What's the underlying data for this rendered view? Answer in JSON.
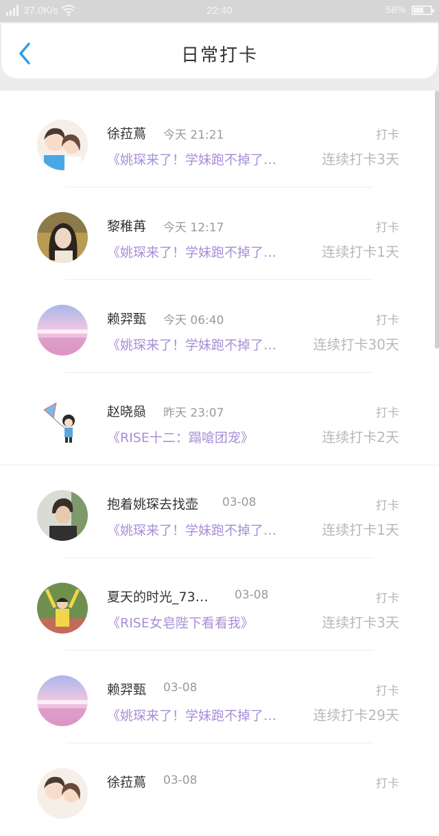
{
  "status": {
    "speed": "37.0K/s",
    "time": "22:40",
    "battery": "58%",
    "battery_level": 0.58
  },
  "header": {
    "title": "日常打卡"
  },
  "entries": [
    {
      "name": "徐菈蔦",
      "time": "今天 21:21",
      "action": "打卡",
      "topic": "《姚琛来了！学妹跑不掉了…",
      "streak": "连续打卡3天",
      "avatar": "couple-illustration"
    },
    {
      "name": "黎稚苒",
      "time": "今天 12:17",
      "action": "打卡",
      "topic": "《姚琛来了！学妹跑不掉了…",
      "streak": "连续打卡1天",
      "avatar": "girl-photo"
    },
    {
      "name": "赖羿甄",
      "time": "今天 06:40",
      "action": "打卡",
      "topic": "《姚琛来了！学妹跑不掉了…",
      "streak": "连续打卡30天",
      "avatar": "pink-sky-scene"
    },
    {
      "name": "赵晓赑",
      "time": "昨天 23:07",
      "action": "打卡",
      "topic": "《RISE十二：蹋嗆团宠》",
      "streak": "连续打卡2天",
      "avatar": "kite-boy-illustration"
    },
    {
      "name": "抱着姚琛去找壶",
      "time": "03-08",
      "action": "打卡",
      "topic": "《姚琛来了！学妹跑不掉了…",
      "streak": "连续打卡1天",
      "avatar": "boy-photo"
    },
    {
      "name": "夏天的时光_73…",
      "time": "03-08",
      "action": "打卡",
      "topic": "《RISE女皂陛下看看我》",
      "streak": "连续打卡3天",
      "avatar": "yellow-girl-photo"
    },
    {
      "name": "赖羿甄",
      "time": "03-08",
      "action": "打卡",
      "topic": "《姚琛来了！学妹跑不掉了…",
      "streak": "连续打卡29天",
      "avatar": "pink-sky-scene"
    },
    {
      "name": "徐菈蔦",
      "time": "03-08",
      "action": "打卡",
      "topic": "",
      "streak": "",
      "avatar": "couple-illustration"
    }
  ]
}
